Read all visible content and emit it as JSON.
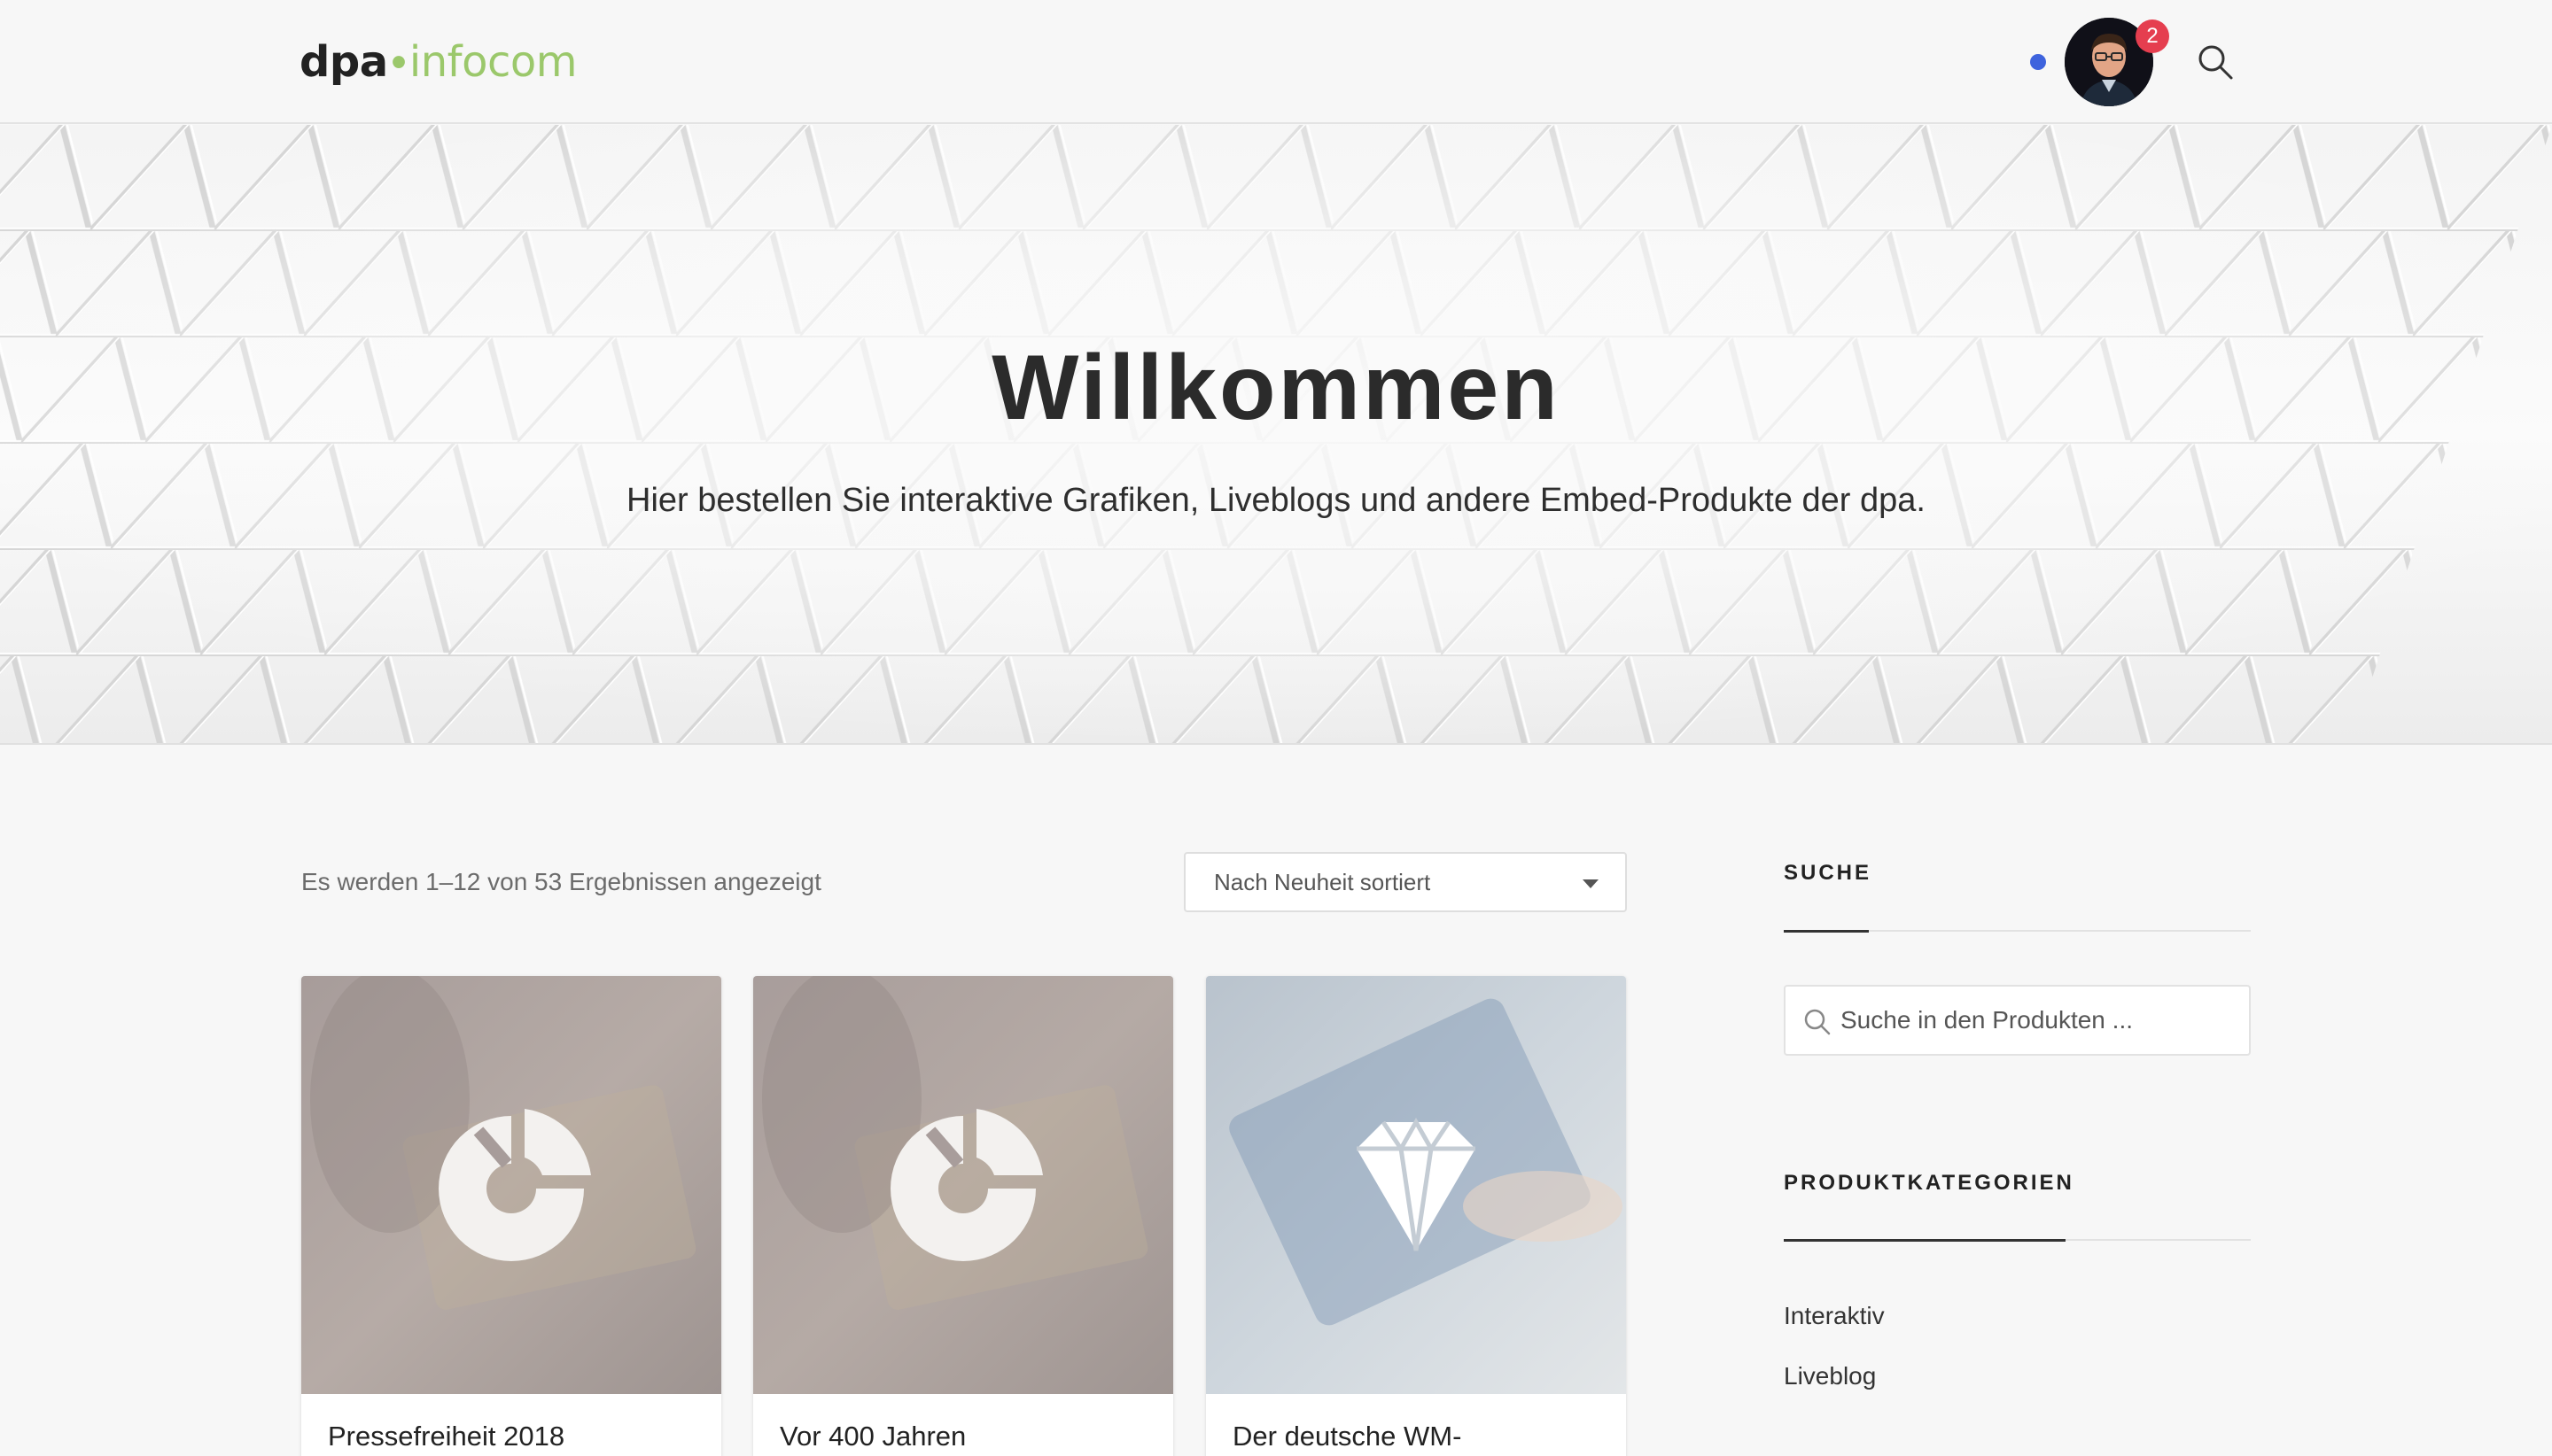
{
  "header": {
    "logo_dpa": "dpa",
    "logo_dot": "•",
    "logo_infocom": "infocom",
    "notification_count": "2"
  },
  "hero": {
    "title": "Willkommen",
    "subtitle": "Hier bestellen Sie interaktive Grafiken, Liveblogs und andere Embed-Produkte der dpa."
  },
  "results": {
    "count_text": "Es werden 1–12 von 53 Ergebnissen angezeigt",
    "sort_selected": "Nach Neuheit sortiert"
  },
  "products": [
    {
      "title": "Pressefreiheit 2018",
      "icon": "pie-chart-icon"
    },
    {
      "title": "Vor 400 Jahren",
      "icon": "pie-chart-icon"
    },
    {
      "title": "Der deutsche WM-",
      "icon": "diamond-icon"
    }
  ],
  "sidebar": {
    "search_heading": "SUCHE",
    "search_placeholder": "Suche in den Produkten ...",
    "categories_heading": "PRODUKTKATEGORIEN",
    "categories": [
      "Interaktiv",
      "Liveblog"
    ]
  },
  "colors": {
    "accent_green": "#9bc86b",
    "online_blue": "#3e63dd",
    "badge_red": "#e53e4f"
  }
}
